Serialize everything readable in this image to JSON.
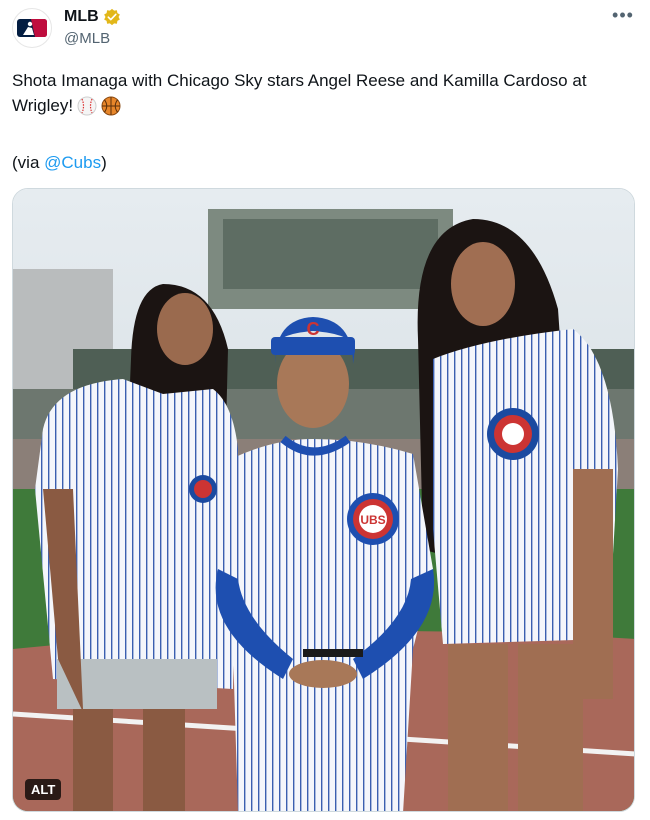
{
  "account": {
    "display_name": "MLB",
    "handle": "@MLB",
    "avatar_icon": "mlb-logo-icon",
    "verified_icon": "gold-verified-badge-icon"
  },
  "menu": {
    "more_label": "•••"
  },
  "tweet": {
    "line1": "Shota Imanaga with Chicago Sky stars Angel Reese and Kamilla Cardoso at",
    "line2": "Wrigley!",
    "emojis": [
      "baseball-emoji",
      "basketball-emoji"
    ],
    "via_prefix": "(via ",
    "via_mention": "@Cubs",
    "via_suffix": ")"
  },
  "media": {
    "alt_label": "ALT",
    "cap_logo_letter": "C",
    "jersey_text": "UBS"
  },
  "colors": {
    "link": "#1d9bf0",
    "cubs_blue": "#0e3386",
    "cubs_red": "#cc3433",
    "grass": "#3f7a3a"
  }
}
